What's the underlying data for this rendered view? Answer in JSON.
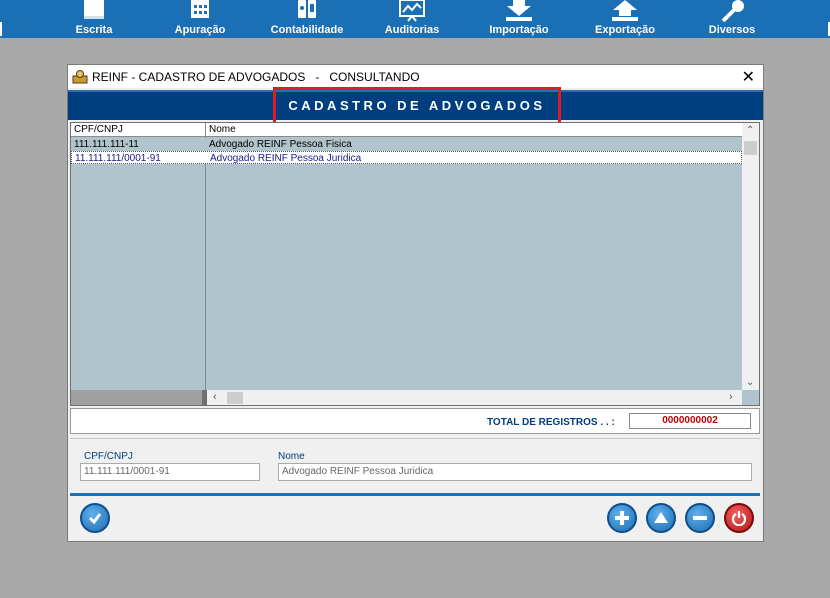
{
  "toolbar": {
    "items": [
      {
        "label": "Escrita",
        "icon": "book-icon"
      },
      {
        "label": "Apuração",
        "icon": "calculator-icon"
      },
      {
        "label": "Contabilidade",
        "icon": "accounting-icon"
      },
      {
        "label": "Auditorias",
        "icon": "chart-board-icon"
      },
      {
        "label": "Importação",
        "icon": "download-icon"
      },
      {
        "label": "Exportação",
        "icon": "upload-icon"
      },
      {
        "label": "Diversos",
        "icon": "microphone-icon"
      }
    ]
  },
  "dialog": {
    "title": "REINF - CADASTRO DE ADVOGADOS   -   CONSULTANDO",
    "close": "✕",
    "banner": "CADASTRO DE ADVOGADOS"
  },
  "grid": {
    "columns": [
      "CPF/CNPJ",
      "Nome"
    ],
    "rows": [
      {
        "cpf": "111.111.111-11",
        "nome": "Advogado REINF Pessoa Fisica"
      },
      {
        "cpf": "11.111.111/0001-91",
        "nome": "Advogado REINF Pessoa Juridica"
      }
    ],
    "selected_row": 1
  },
  "total": {
    "label": "TOTAL DE REGISTROS . . :",
    "value": "0000000002"
  },
  "form": {
    "cpf_label": "CPF/CNPJ",
    "cpf_value": "11.111.111/0001-91",
    "nome_label": "Nome",
    "nome_value": "Advogado REINF Pessoa Juridica"
  },
  "colors": {
    "toolbar": "#1a6fb5",
    "banner": "#003f7f",
    "highlight_border": "#e01b24",
    "total_value": "#c00000"
  }
}
